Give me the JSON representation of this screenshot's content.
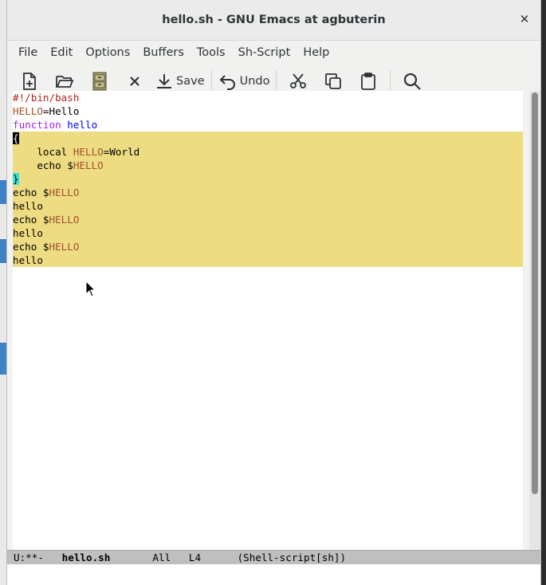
{
  "window": {
    "title": "hello.sh - GNU Emacs at agbuterin"
  },
  "menu": [
    "File",
    "Edit",
    "Options",
    "Buffers",
    "Tools",
    "Sh-Script",
    "Help"
  ],
  "toolbar": {
    "save_label": "Save",
    "undo_label": "Undo"
  },
  "code_lines": [
    {
      "segments": [
        {
          "t": "#!/bin/bash",
          "c": "comment"
        }
      ],
      "hl": false
    },
    {
      "segments": [
        {
          "t": "HELLO",
          "c": "var"
        },
        {
          "t": "=Hello",
          "c": ""
        }
      ],
      "hl": false
    },
    {
      "segments": [
        {
          "t": "function",
          "c": "kw"
        },
        {
          "t": " ",
          "c": ""
        },
        {
          "t": "hello",
          "c": "fn"
        }
      ],
      "hl": false
    },
    {
      "segments": [
        {
          "t": "{",
          "c": "cursor"
        }
      ],
      "hl": true
    },
    {
      "segments": [
        {
          "t": "    local ",
          "c": ""
        },
        {
          "t": "HELLO",
          "c": "var"
        },
        {
          "t": "=World",
          "c": ""
        }
      ],
      "hl": true
    },
    {
      "segments": [
        {
          "t": "    echo $",
          "c": ""
        },
        {
          "t": "HELLO",
          "c": "var"
        }
      ],
      "hl": true
    },
    {
      "segments": [
        {
          "t": "}",
          "c": "paren"
        }
      ],
      "hl": true
    },
    {
      "segments": [
        {
          "t": "echo $",
          "c": ""
        },
        {
          "t": "HELLO",
          "c": "var"
        }
      ],
      "hl": true
    },
    {
      "segments": [
        {
          "t": "hello",
          "c": ""
        }
      ],
      "hl": true
    },
    {
      "segments": [
        {
          "t": "echo $",
          "c": ""
        },
        {
          "t": "HELLO",
          "c": "var"
        }
      ],
      "hl": true
    },
    {
      "segments": [
        {
          "t": "hello",
          "c": ""
        }
      ],
      "hl": true
    },
    {
      "segments": [
        {
          "t": "echo $",
          "c": ""
        },
        {
          "t": "HELLO",
          "c": "var"
        }
      ],
      "hl": true
    },
    {
      "segments": [
        {
          "t": "hello",
          "c": ""
        }
      ],
      "hl": true
    }
  ],
  "modeline": {
    "status": "U:**-",
    "buffer": "hello.sh",
    "position": "All",
    "line": "L4",
    "mode": "(Shell-script[sh])"
  },
  "colors": {
    "region": "#eedc82",
    "comment": "#b22222",
    "variable": "#a0522d",
    "keyword": "#a020f0",
    "function": "#0000ff"
  }
}
